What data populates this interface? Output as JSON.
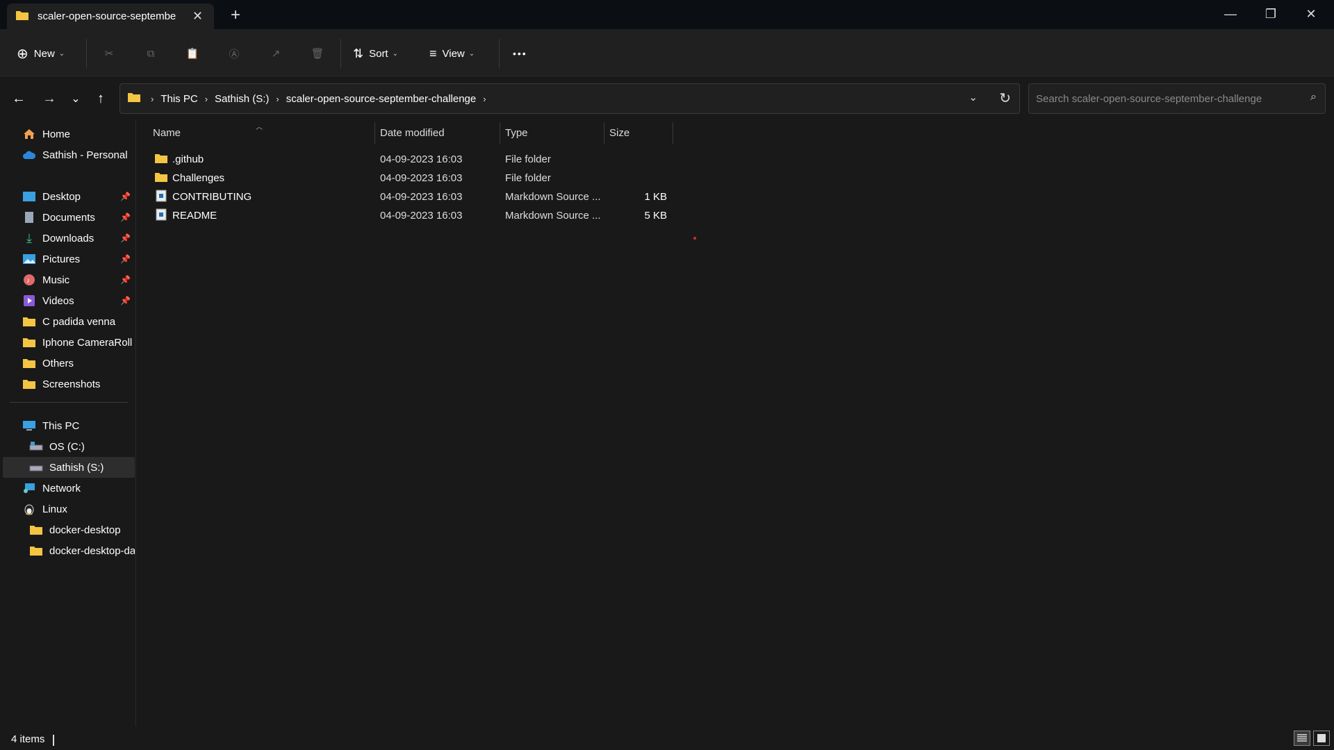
{
  "tab": {
    "title": "scaler-open-source-septembe"
  },
  "toolbar": {
    "new_label": "New",
    "sort_label": "Sort",
    "view_label": "View",
    "more_label": "•••"
  },
  "breadcrumb": [
    "This PC",
    "Sathish (S:)",
    "scaler-open-source-september-challenge"
  ],
  "search": {
    "placeholder": "Search scaler-open-source-september-challenge"
  },
  "sidebar": {
    "items": [
      {
        "label": "Home"
      },
      {
        "label": "Sathish - Personal"
      },
      {
        "label": "Desktop"
      },
      {
        "label": "Documents"
      },
      {
        "label": "Downloads"
      },
      {
        "label": "Pictures"
      },
      {
        "label": "Music"
      },
      {
        "label": "Videos"
      },
      {
        "label": "C padida venna"
      },
      {
        "label": "Iphone CameraRoll"
      },
      {
        "label": "Others"
      },
      {
        "label": "Screenshots"
      },
      {
        "label": "This PC"
      },
      {
        "label": "OS (C:)"
      },
      {
        "label": "Sathish (S:)"
      },
      {
        "label": "Network"
      },
      {
        "label": "Linux"
      },
      {
        "label": "docker-desktop"
      },
      {
        "label": "docker-desktop-da"
      }
    ]
  },
  "columns": {
    "name": "Name",
    "date": "Date modified",
    "type": "Type",
    "size": "Size"
  },
  "files": [
    {
      "name": ".github",
      "date": "04-09-2023 16:03",
      "type": "File folder",
      "size": ""
    },
    {
      "name": "Challenges",
      "date": "04-09-2023 16:03",
      "type": "File folder",
      "size": ""
    },
    {
      "name": "CONTRIBUTING",
      "date": "04-09-2023 16:03",
      "type": "Markdown Source ...",
      "size": "1 KB"
    },
    {
      "name": "README",
      "date": "04-09-2023 16:03",
      "type": "Markdown Source ...",
      "size": "5 KB"
    }
  ],
  "status": {
    "count": "4 items"
  },
  "colors": {
    "folder": "#f4c542",
    "onedrive": "#2b88d8",
    "background": "#191919"
  }
}
